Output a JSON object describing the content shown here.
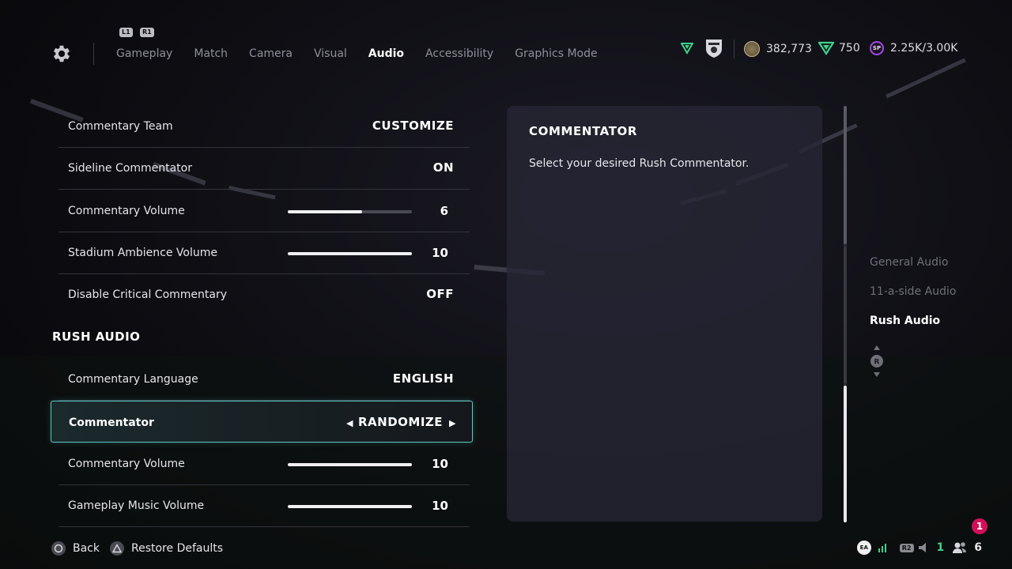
{
  "header": {
    "shoulder_left": "L1",
    "shoulder_right": "R1",
    "tabs": [
      {
        "label": "Gameplay",
        "active": false
      },
      {
        "label": "Match",
        "active": false
      },
      {
        "label": "Camera",
        "active": false
      },
      {
        "label": "Visual",
        "active": false
      },
      {
        "label": "Audio",
        "active": true
      },
      {
        "label": "Accessibility",
        "active": false
      },
      {
        "label": "Graphics Mode",
        "active": false
      }
    ],
    "currencies": {
      "coins": "382,773",
      "points": "750",
      "sp_label": "SP",
      "sp": "2.25K/3.00K"
    }
  },
  "settings": {
    "rows": [
      {
        "label": "Commentary Team",
        "value": "CUSTOMIZE"
      },
      {
        "label": "Sideline Commentator",
        "value": "ON"
      },
      {
        "label": "Commentary Volume",
        "value": "6",
        "level": 0.6
      },
      {
        "label": "Stadium Ambience Volume",
        "value": "10",
        "level": 1.0
      },
      {
        "label": "Disable Critical Commentary",
        "value": "OFF"
      }
    ],
    "rush_section_title": "RUSH AUDIO",
    "rush_rows": [
      {
        "label": "Commentary Language",
        "value": "ENGLISH"
      },
      {
        "label": "Commentator",
        "value": "RANDOMIZE",
        "selected": true
      },
      {
        "label": "Commentary Volume",
        "value": "10",
        "level": 1.0
      },
      {
        "label": "Gameplay Music Volume",
        "value": "10",
        "level": 1.0
      }
    ]
  },
  "description": {
    "title": "COMMENTATOR",
    "text": "Select your desired Rush Commentator."
  },
  "section_nav": {
    "items": [
      {
        "label": "General Audio",
        "active": false
      },
      {
        "label": "11-a-side Audio",
        "active": false
      },
      {
        "label": "Rush Audio",
        "active": true
      }
    ],
    "stick_label": "R"
  },
  "footer": {
    "back_label": "Back",
    "restore_label": "Restore Defaults",
    "tray": {
      "ea_label": "EA",
      "r2_label": "R2",
      "mic_count": "1",
      "party_count": "6"
    },
    "notification_count": "1"
  },
  "colors": {
    "accent_teal": "#5fc7c3",
    "points_green": "#3fd28c",
    "sp_purple": "#a04be0",
    "notif_pink": "#d2105a"
  }
}
